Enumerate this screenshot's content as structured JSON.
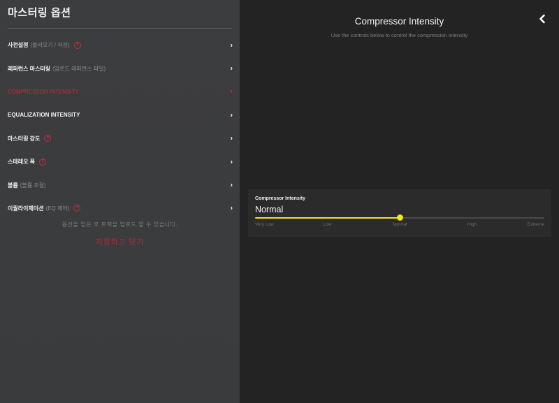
{
  "left": {
    "title": "마스터링 옵션",
    "menu": [
      {
        "label": "사전설정",
        "sub": "(불러오기 / 저장)",
        "help": "?",
        "active": false
      },
      {
        "label": "레퍼런스 마스터링",
        "sub": "(업로드 레퍼런스 파일)",
        "help": "",
        "active": false
      },
      {
        "label": "COMPRESSOR INTENSITY",
        "sub": "",
        "help": "",
        "active": true
      },
      {
        "label": "EQUALIZATION INTENSITY",
        "sub": "",
        "help": "",
        "active": false
      },
      {
        "label": "마스터링 강도",
        "sub": "",
        "help": "?",
        "active": false
      },
      {
        "label": "스테레오 폭",
        "sub": "",
        "help": "?",
        "active": false
      },
      {
        "label": "볼륨",
        "sub": "(볼륨 조절)",
        "help": "",
        "active": false
      },
      {
        "label": "이퀄라이제이션",
        "sub": "(EQ 제어)",
        "help": "?",
        "active": false
      }
    ],
    "note": "옵션을 얻은 후 트랙을 업로드 할 수 있습니다.",
    "save_close": "저장하고 닫기"
  },
  "right": {
    "title": "Compressor Intensity",
    "subtitle": "Use the controls below to control the compression intensity",
    "card": {
      "label": "Compressor Intensity",
      "value": "Normal",
      "slider_level": 0.5,
      "ticks": [
        "Very Low",
        "Low",
        "Normal",
        "High",
        "Extreme"
      ]
    }
  },
  "colors": {
    "accent": "#d3263a",
    "slider": "#f7e21c"
  },
  "icons": {
    "menu_chevron": "chevron-right-icon",
    "back": "chevron-left-icon",
    "help": "question-circle-icon"
  }
}
